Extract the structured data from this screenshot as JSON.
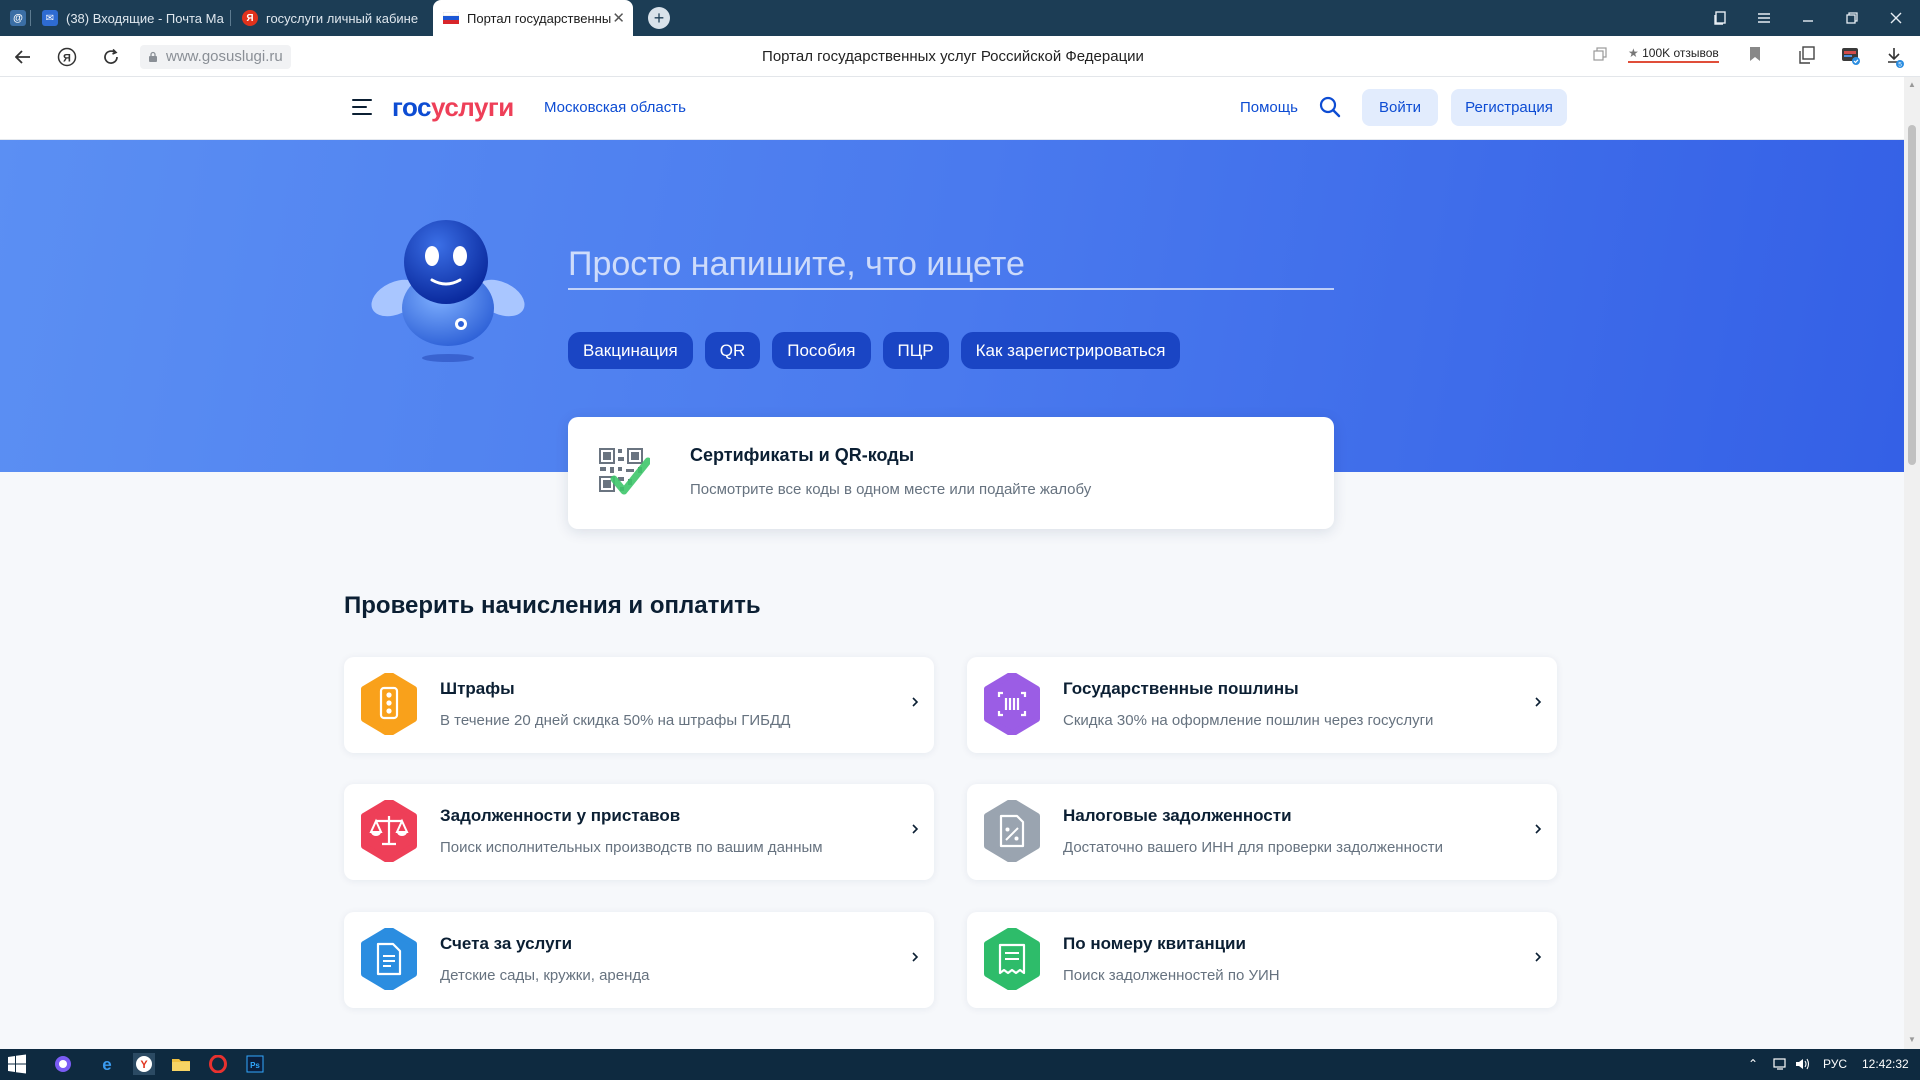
{
  "browser": {
    "tabs": [
      {
        "label": "",
        "fav_color": "#3a6ea5",
        "fav_glyph": "@"
      },
      {
        "label": "(38) Входящие - Почта Ма",
        "fav_color": "#2e6bd1",
        "fav_glyph": "✉"
      },
      {
        "label": "госуслуги личный кабине",
        "fav_color": "#e0321c",
        "fav_glyph": "Я"
      },
      {
        "label": "Портал государственны",
        "fav_color": "#ffffff",
        "fav_glyph": "",
        "active": true
      }
    ],
    "address": "www.gosuslugi.ru",
    "page_title": "Портал государственных услуг Российской Федерации",
    "reviews": "100K отзывов",
    "download_badge": "5"
  },
  "header": {
    "logo_part1": "гос",
    "logo_part2": "услуги",
    "region": "Московская область",
    "help": "Помощь",
    "login": "Войти",
    "register": "Регистрация"
  },
  "hero": {
    "search_placeholder": "Просто напишите, что ищете",
    "chips": [
      "Вакцинация",
      "QR",
      "Пособия",
      "ПЦР",
      "Как зарегистрироваться"
    ]
  },
  "certificate": {
    "title": "Сертификаты и QR-коды",
    "desc": "Посмотрите все коды в одном месте или подайте жалобу"
  },
  "payments": {
    "title": "Проверить начисления и оплатить",
    "cards": [
      {
        "title": "Штрафы",
        "desc": "В течение 20 дней скидка 50% на штрафы ГИБДД",
        "color": "#f9a11b",
        "icon": "traffic-light-icon"
      },
      {
        "title": "Государственные пошлины",
        "desc": "Скидка 30% на оформление пошлин через госуслуги",
        "color": "#9b5de5",
        "icon": "barcode-icon"
      },
      {
        "title": "Задолженности у приставов",
        "desc": "Поиск исполнительных производств по вашим данным",
        "color": "#ee3f58",
        "icon": "scales-icon"
      },
      {
        "title": "Налоговые задолженности",
        "desc": "Достаточно вашего ИНН для проверки задолженности",
        "color": "#9aa4b0",
        "icon": "tax-document-icon"
      },
      {
        "title": "Счета за услуги",
        "desc": "Детские сады, кружки, аренда",
        "color": "#2b8de0",
        "icon": "invoice-icon"
      },
      {
        "title": "По номеру квитанции",
        "desc": "Поиск задолженностей по УИН",
        "color": "#2ebc6a",
        "icon": "receipt-icon"
      }
    ]
  },
  "taskbar": {
    "lang": "РУС",
    "time": "12:42:32"
  }
}
